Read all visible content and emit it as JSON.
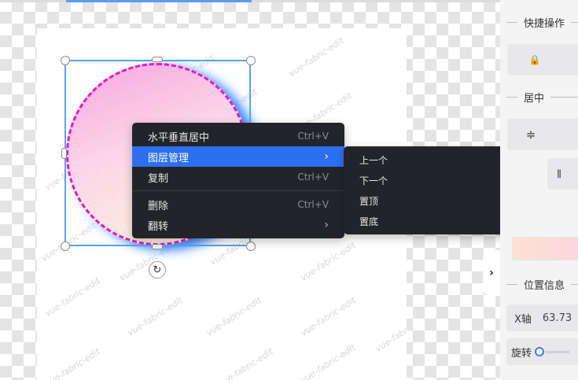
{
  "canvas": {
    "watermark": "vue-fabric-edit",
    "rotate_icon": "↻"
  },
  "context_menu": {
    "items": [
      {
        "label": "水平垂直居中",
        "shortcut": "Ctrl+V"
      },
      {
        "label": "图层管理",
        "chevron": "›"
      },
      {
        "label": "复制",
        "shortcut": "Ctrl+V"
      },
      {
        "label": "删除",
        "shortcut": "Ctrl+V"
      },
      {
        "label": "翻转",
        "chevron": "›"
      }
    ],
    "active_index": 1
  },
  "sub_menu": {
    "items": [
      {
        "label": "上一个",
        "shortcut": "key"
      },
      {
        "label": "下一个",
        "shortcut": "key"
      },
      {
        "label": "置顶",
        "shortcut": "key"
      },
      {
        "label": "置底",
        "shortcut": "key"
      }
    ]
  },
  "panel": {
    "collapse_icon": "›",
    "quick_ops_title": "快捷操作",
    "lock_icon": "🔒",
    "center_title": "居中",
    "align_v_icon": "≑",
    "align_h_icon": "⫼",
    "position_title": "位置信息",
    "x_label": "X轴",
    "x_value": "63.73",
    "rotate_label": "旋转"
  },
  "colors": {
    "accent": "#2e6ff2",
    "menu_bg": "#222429",
    "selection": "#56a3f1",
    "circle_dash": "#e619c7"
  }
}
